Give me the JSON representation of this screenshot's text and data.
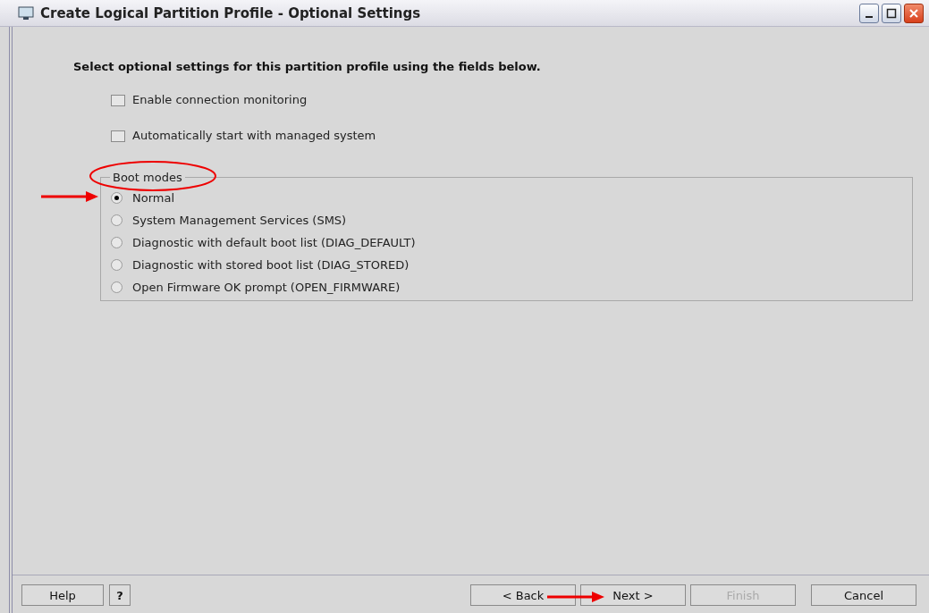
{
  "window": {
    "title": "Create Logical Partition Profile - Optional Settings"
  },
  "instruction": "Select optional settings for this partition profile using the fields below.",
  "options": [
    {
      "label": "Enable connection monitoring",
      "checked": false
    },
    {
      "label": "Automatically start with managed system",
      "checked": false
    }
  ],
  "boot_modes": {
    "title": "Boot modes",
    "items": [
      {
        "label": "Normal",
        "selected": true
      },
      {
        "label": "System Management Services (SMS)",
        "selected": false
      },
      {
        "label": "Diagnostic with default boot list (DIAG_DEFAULT)",
        "selected": false
      },
      {
        "label": "Diagnostic with stored boot list (DIAG_STORED)",
        "selected": false
      },
      {
        "label": "Open Firmware OK prompt (OPEN_FIRMWARE)",
        "selected": false
      }
    ]
  },
  "buttons_left": [
    {
      "label": "Help",
      "kind": "wide"
    },
    {
      "label": "?",
      "kind": "small"
    }
  ],
  "buttons_right": [
    {
      "label": "< Back",
      "disabled": false
    },
    {
      "label": "Next >",
      "disabled": false
    },
    {
      "label": "Finish",
      "disabled": true
    },
    {
      "label": "Cancel",
      "disabled": false
    }
  ],
  "annotations": [
    {
      "kind": "ellipse"
    },
    {
      "kind": "arrow-normal"
    },
    {
      "kind": "arrow-next"
    }
  ]
}
